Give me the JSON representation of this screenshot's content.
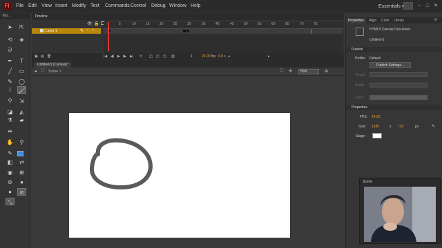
{
  "app": {
    "logo": "Fl"
  },
  "menu": [
    "File",
    "Edit",
    "View",
    "Insert",
    "Modify",
    "Text",
    "Commands",
    "Control",
    "Debug",
    "Window",
    "Help"
  ],
  "workspace": {
    "label": "Essentials ▾"
  },
  "tools": {
    "header": "Too..."
  },
  "timeline": {
    "tab_label": "Timeline",
    "layer_name": "Layer 1",
    "frame_numbers": [
      "5",
      "10",
      "15",
      "20",
      "25",
      "30",
      "35",
      "40",
      "45",
      "50",
      "55",
      "60",
      "65",
      "70",
      "75"
    ],
    "current_frame": "1",
    "fps": "24.00",
    "fps_unit": "fps",
    "time": "0.0 s"
  },
  "document": {
    "tab_label": "Untitled-5 (Canvas)*",
    "scene_crumb": "Scene 1",
    "zoom": "50%"
  },
  "properties": {
    "tabs": [
      "Properties",
      "Align",
      "Color",
      "Library"
    ],
    "doc_type": "HTML5 Canvas Document",
    "doc_name": "Untitled-5",
    "publish_section": "Publish",
    "profile_label": "Profile:",
    "profile_value": "Default",
    "publish_settings_button": "Publish Settings...",
    "target_label": "Target:",
    "script_label": "Script:",
    "class_label": "Class:",
    "properties_section": "Properties",
    "fps_label": "FPS:",
    "fps_value": "24.00",
    "size_label": "Size:",
    "width": "1280",
    "x_sep": "x",
    "height": "720",
    "unit": "px",
    "stage_label": "Stage:",
    "stage_color": "#ffffff"
  },
  "webcam": {
    "title": "Scene"
  },
  "colors": {
    "accent_orange": "#e0a040",
    "playhead": "#dd3333",
    "layer_highlight": "#b8860b",
    "stroke_color": "#5a5a5a",
    "fill_color": "#3b8ee8"
  }
}
